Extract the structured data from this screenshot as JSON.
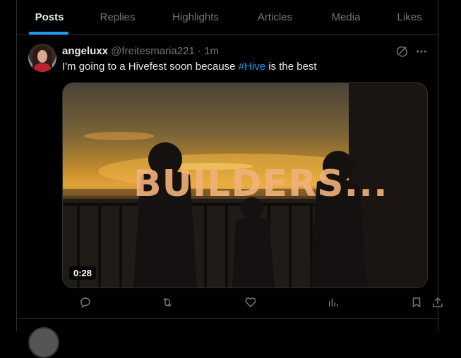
{
  "tabs": [
    {
      "label": "Posts",
      "active": true
    },
    {
      "label": "Replies"
    },
    {
      "label": "Highlights"
    },
    {
      "label": "Articles"
    },
    {
      "label": "Media"
    },
    {
      "label": "Likes"
    }
  ],
  "post": {
    "display_name": "angeluxx",
    "handle": "@freitesmaria221",
    "separator": "·",
    "time": "1m",
    "text_before": "I'm going to a Hivefest soon because ",
    "hashtag": "#Hive",
    "text_after": " is the best",
    "media": {
      "overlay_text": "BUILDERS...",
      "duration": "0:28"
    }
  },
  "icons": {
    "grok": "grok-icon",
    "more": "more-options-icon",
    "reply": "reply-icon",
    "repost": "repost-icon",
    "like": "like-icon",
    "views": "views-icon",
    "bookmark": "bookmark-icon",
    "share": "share-icon"
  },
  "colors": {
    "accent": "#1d9bf0",
    "muted": "#71767b",
    "text": "#e7e9ea",
    "border": "#2f3336",
    "background": "#000000"
  }
}
